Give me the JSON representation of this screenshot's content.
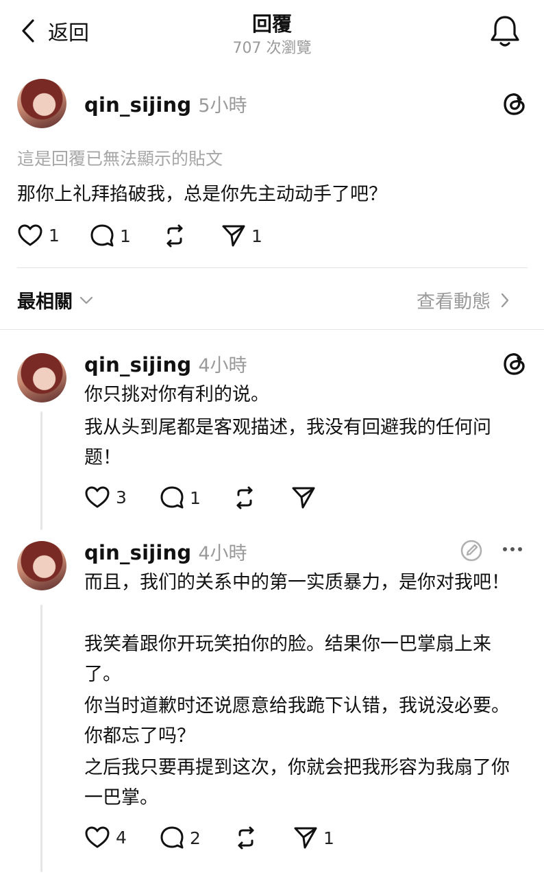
{
  "header": {
    "back_label": "返回",
    "title": "回覆",
    "views": "707 次瀏覽"
  },
  "original_post": {
    "username": "qin_sijing",
    "time": "5小時",
    "unavailable_note": "這是回覆已無法顯示的貼文",
    "text": "那你上礼拜掐破我，总是你先主动动手了吧？",
    "likes": "1",
    "comments": "1",
    "shares": "1"
  },
  "sort": {
    "label": "最相關",
    "activity_label": "查看動態"
  },
  "replies": [
    {
      "username": "qin_sijing",
      "time": "4小時",
      "lines": [
        "你只挑对你有利的说。",
        "我从头到尾都是客观描述，我没有回避我的任何问题！"
      ],
      "likes": "3",
      "comments": "1"
    },
    {
      "username": "qin_sijing",
      "time": "4小時",
      "lines": [
        "而且，我们的关系中的第一实质暴力，是你对我吧！",
        "我笑着跟你开玩笑拍你的脸。结果你一巴掌扇上来了。",
        "你当时道歉时还说愿意给我跪下认错，我说没必要。你都忘了吗？",
        "之后我只要再提到这次，你就会把我形容为我扇了你一巴掌。"
      ],
      "likes": "4",
      "comments": "2",
      "shares": "1"
    }
  ],
  "colors": {
    "text": "#101010",
    "muted": "#9a9a9a",
    "divider": "#e3e3e3",
    "background": "#ffffff"
  },
  "icons": [
    "chevron-left-icon",
    "bell-icon",
    "threads-icon",
    "heart-icon",
    "comment-icon",
    "repost-icon",
    "send-icon",
    "chevron-down-icon",
    "chevron-right-icon",
    "edit-circle-icon",
    "more-icon"
  ]
}
